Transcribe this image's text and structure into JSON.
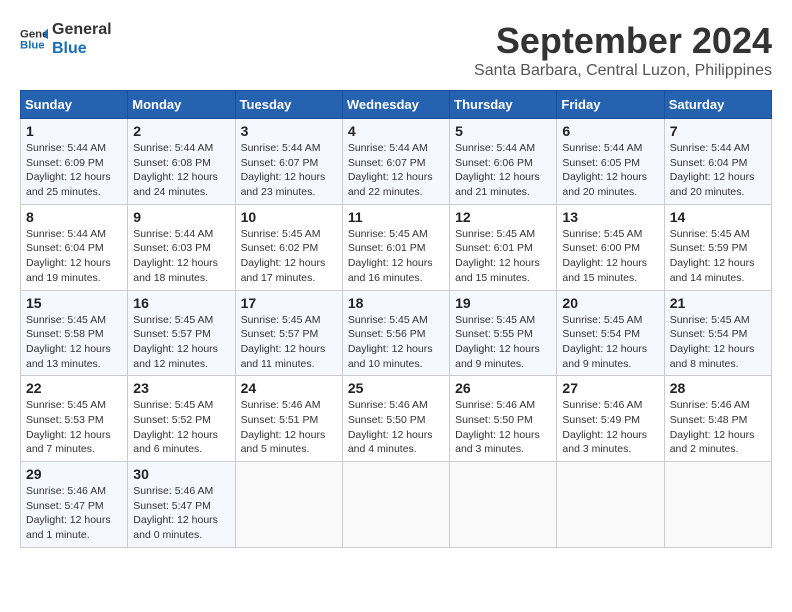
{
  "logo": {
    "line1": "General",
    "line2": "Blue"
  },
  "title": "September 2024",
  "location": "Santa Barbara, Central Luzon, Philippines",
  "weekdays": [
    "Sunday",
    "Monday",
    "Tuesday",
    "Wednesday",
    "Thursday",
    "Friday",
    "Saturday"
  ],
  "days": [
    {
      "date": "",
      "info": ""
    },
    {
      "date": "",
      "info": ""
    },
    {
      "date": "",
      "info": ""
    },
    {
      "date": "",
      "info": ""
    },
    {
      "date": "",
      "info": ""
    },
    {
      "date": "",
      "info": ""
    },
    {
      "date": "1",
      "info": "Sunrise: 5:44 AM\nSunset: 6:09 PM\nDaylight: 12 hours\nand 25 minutes."
    },
    {
      "date": "2",
      "info": "Sunrise: 5:44 AM\nSunset: 6:08 PM\nDaylight: 12 hours\nand 24 minutes."
    },
    {
      "date": "3",
      "info": "Sunrise: 5:44 AM\nSunset: 6:07 PM\nDaylight: 12 hours\nand 23 minutes."
    },
    {
      "date": "4",
      "info": "Sunrise: 5:44 AM\nSunset: 6:07 PM\nDaylight: 12 hours\nand 22 minutes."
    },
    {
      "date": "5",
      "info": "Sunrise: 5:44 AM\nSunset: 6:06 PM\nDaylight: 12 hours\nand 21 minutes."
    },
    {
      "date": "6",
      "info": "Sunrise: 5:44 AM\nSunset: 6:05 PM\nDaylight: 12 hours\nand 20 minutes."
    },
    {
      "date": "7",
      "info": "Sunrise: 5:44 AM\nSunset: 6:04 PM\nDaylight: 12 hours\nand 20 minutes."
    },
    {
      "date": "8",
      "info": "Sunrise: 5:44 AM\nSunset: 6:04 PM\nDaylight: 12 hours\nand 19 minutes."
    },
    {
      "date": "9",
      "info": "Sunrise: 5:44 AM\nSunset: 6:03 PM\nDaylight: 12 hours\nand 18 minutes."
    },
    {
      "date": "10",
      "info": "Sunrise: 5:45 AM\nSunset: 6:02 PM\nDaylight: 12 hours\nand 17 minutes."
    },
    {
      "date": "11",
      "info": "Sunrise: 5:45 AM\nSunset: 6:01 PM\nDaylight: 12 hours\nand 16 minutes."
    },
    {
      "date": "12",
      "info": "Sunrise: 5:45 AM\nSunset: 6:01 PM\nDaylight: 12 hours\nand 15 minutes."
    },
    {
      "date": "13",
      "info": "Sunrise: 5:45 AM\nSunset: 6:00 PM\nDaylight: 12 hours\nand 15 minutes."
    },
    {
      "date": "14",
      "info": "Sunrise: 5:45 AM\nSunset: 5:59 PM\nDaylight: 12 hours\nand 14 minutes."
    },
    {
      "date": "15",
      "info": "Sunrise: 5:45 AM\nSunset: 5:58 PM\nDaylight: 12 hours\nand 13 minutes."
    },
    {
      "date": "16",
      "info": "Sunrise: 5:45 AM\nSunset: 5:57 PM\nDaylight: 12 hours\nand 12 minutes."
    },
    {
      "date": "17",
      "info": "Sunrise: 5:45 AM\nSunset: 5:57 PM\nDaylight: 12 hours\nand 11 minutes."
    },
    {
      "date": "18",
      "info": "Sunrise: 5:45 AM\nSunset: 5:56 PM\nDaylight: 12 hours\nand 10 minutes."
    },
    {
      "date": "19",
      "info": "Sunrise: 5:45 AM\nSunset: 5:55 PM\nDaylight: 12 hours\nand 9 minutes."
    },
    {
      "date": "20",
      "info": "Sunrise: 5:45 AM\nSunset: 5:54 PM\nDaylight: 12 hours\nand 9 minutes."
    },
    {
      "date": "21",
      "info": "Sunrise: 5:45 AM\nSunset: 5:54 PM\nDaylight: 12 hours\nand 8 minutes."
    },
    {
      "date": "22",
      "info": "Sunrise: 5:45 AM\nSunset: 5:53 PM\nDaylight: 12 hours\nand 7 minutes."
    },
    {
      "date": "23",
      "info": "Sunrise: 5:45 AM\nSunset: 5:52 PM\nDaylight: 12 hours\nand 6 minutes."
    },
    {
      "date": "24",
      "info": "Sunrise: 5:46 AM\nSunset: 5:51 PM\nDaylight: 12 hours\nand 5 minutes."
    },
    {
      "date": "25",
      "info": "Sunrise: 5:46 AM\nSunset: 5:50 PM\nDaylight: 12 hours\nand 4 minutes."
    },
    {
      "date": "26",
      "info": "Sunrise: 5:46 AM\nSunset: 5:50 PM\nDaylight: 12 hours\nand 3 minutes."
    },
    {
      "date": "27",
      "info": "Sunrise: 5:46 AM\nSunset: 5:49 PM\nDaylight: 12 hours\nand 3 minutes."
    },
    {
      "date": "28",
      "info": "Sunrise: 5:46 AM\nSunset: 5:48 PM\nDaylight: 12 hours\nand 2 minutes."
    },
    {
      "date": "29",
      "info": "Sunrise: 5:46 AM\nSunset: 5:47 PM\nDaylight: 12 hours\nand 1 minute."
    },
    {
      "date": "30",
      "info": "Sunrise: 5:46 AM\nSunset: 5:47 PM\nDaylight: 12 hours\nand 0 minutes."
    },
    {
      "date": "",
      "info": ""
    },
    {
      "date": "",
      "info": ""
    },
    {
      "date": "",
      "info": ""
    },
    {
      "date": "",
      "info": ""
    },
    {
      "date": "",
      "info": ""
    }
  ]
}
